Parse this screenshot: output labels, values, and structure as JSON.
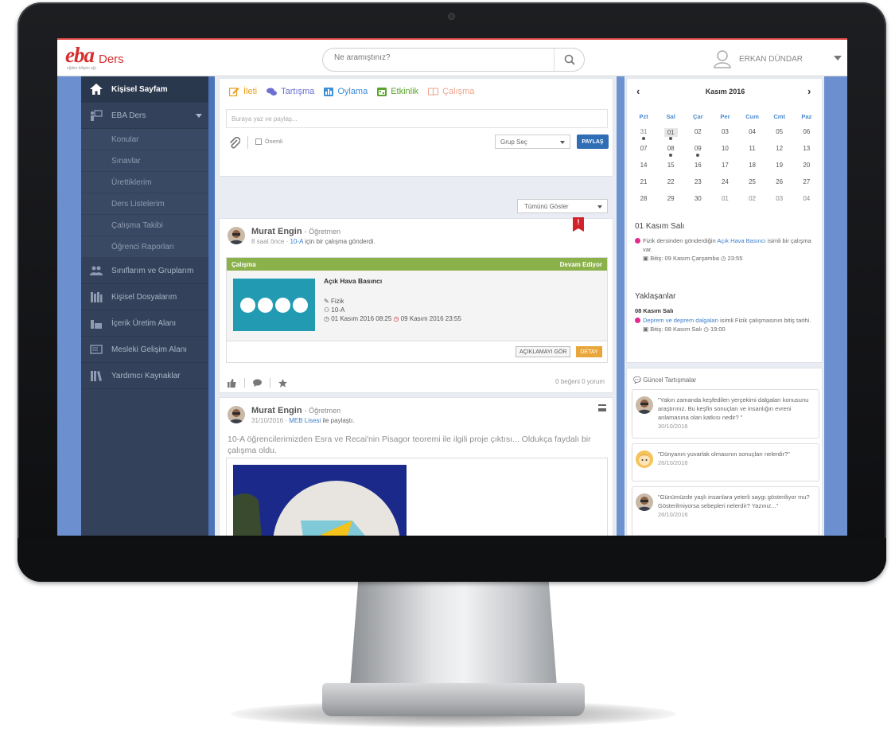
{
  "app": {
    "logo_text": "eba",
    "logo_sub": "Ders",
    "logo_tagline": "eğitim bilişim ağı"
  },
  "search": {
    "placeholder": "Ne aramıştınız?"
  },
  "user": {
    "name": "ERKAN DÜNDAR"
  },
  "sidebar": {
    "items": [
      {
        "label": "Kişisel Sayfam",
        "icon": "home-icon"
      },
      {
        "label": "EBA Ders",
        "icon": "teacher-board-icon"
      },
      {
        "label": "Konular"
      },
      {
        "label": "Sınavlar"
      },
      {
        "label": "Ürettiklerim"
      },
      {
        "label": "Ders Listelerim"
      },
      {
        "label": "Çalışma Takibi"
      },
      {
        "label": "Öğrenci Raporları"
      },
      {
        "label": "Sınıflarım ve Gruplarım",
        "icon": "users-icon"
      },
      {
        "label": "Kişisel Dosyalarım",
        "icon": "books-icon"
      },
      {
        "label": "İçerik Üretim Alanı",
        "icon": "tools-icon"
      },
      {
        "label": "Mesleki Gelişim Alanı",
        "icon": "certificate-icon"
      },
      {
        "label": "Yardımcı Kaynaklar",
        "icon": "library-icon"
      }
    ]
  },
  "composer": {
    "tabs": [
      {
        "label": "İleti",
        "color": "#e9a020"
      },
      {
        "label": "Tartışma",
        "color": "#6d6fd1"
      },
      {
        "label": "Oylama",
        "color": "#3d8ed8"
      },
      {
        "label": "Etkinlik",
        "color": "#5aa22c"
      },
      {
        "label": "Çalışma",
        "color": "#f0a58e"
      }
    ],
    "input_placeholder": "Buraya yaz ve paylaş...",
    "important_label": "Önemli",
    "group_select": "Grup Seç",
    "share_button": "PAYLAŞ"
  },
  "feed_filter": "Tümünü Göster",
  "posts": [
    {
      "author": "Murat Engin",
      "role": "- Öğretmen",
      "time": "8 saat önce",
      "dot": "·",
      "target": "10-A",
      "action": "için bir çalışma gönderdi.",
      "badge": "!",
      "work": {
        "header": "Çalışma",
        "status": "Devam Ediyor",
        "title": "Açık Hava Basıncı",
        "subject": "Fizik",
        "class": "10-A",
        "start": "01 Kasım 2016 08:25",
        "end": "09 Kasım 2016 23:55",
        "btn_description": "AÇIKLAMAYI GÖR",
        "btn_detail": "DETAY"
      },
      "likes": "0 beğeni",
      "comments": "0 yorum"
    },
    {
      "author": "Murat Engin",
      "role": "- Öğretmen",
      "time": "31/10/2016",
      "dot": "·",
      "target": "MEB Lisesi",
      "action": "ile paylaştı.",
      "text": "10-A öğrencilerimizden Esra ve Recai'nin Pisagor teoremi ile ilgili proje çıktısı... Oldukça faydalı bir çalışma oldu."
    }
  ],
  "calendar": {
    "prev": "‹",
    "next": "›",
    "title": "Kasım 2016",
    "weekdays": [
      "Pzt",
      "Sal",
      "Çar",
      "Per",
      "Cum",
      "Cmt",
      "Paz"
    ],
    "weeks": [
      [
        "31",
        "01",
        "02",
        "03",
        "04",
        "05",
        "06"
      ],
      [
        "07",
        "08",
        "09",
        "10",
        "11",
        "12",
        "13"
      ],
      [
        "14",
        "15",
        "16",
        "17",
        "18",
        "19",
        "20"
      ],
      [
        "21",
        "22",
        "23",
        "24",
        "25",
        "26",
        "27"
      ],
      [
        "28",
        "29",
        "30",
        "01",
        "02",
        "03",
        "04"
      ]
    ],
    "selected_date": "01 Kasım Salı",
    "event1_pre": "Fizik dersinden gönderdiğin",
    "event1_link": "Açık Hava Basıncı",
    "event1_post": "isimli bir çalışma var.",
    "event1_end": "Bitiş: 09 Kasım Çarşamba",
    "event1_time": "23:55",
    "upcoming_title": "Yaklaşanlar",
    "upcoming_date": "08 Kasım Salı",
    "event2_link": "Deprem ve deprem dalgaları",
    "event2_post": "isimli Fizik çalışmasının bitiş tarihi.",
    "event2_end": "Bitiş: 08 Kasım Salı",
    "event2_time": "19:00"
  },
  "discussions": {
    "title": "Güncel Tartışmalar",
    "items": [
      {
        "text": "\"Yakın zamanda keşfedilen yerçekimi dalgaları konusunu araştırınız. Bu keşfin sonuçları ve insanlığın evreni anlamasına olan katkısı nedir? \"",
        "date": "30/10/2016"
      },
      {
        "text": "\"Dünyanın yuvarlak olmasının sonuçları nelerdir?\"",
        "date": "26/10/2016"
      },
      {
        "text": "\"Günümüzde yaşlı insanlara yeterli saygı gösteriliyor mu? Gösterilmiyorsa sebepleri nelerdir? Yazınız...\"",
        "date": "26/10/2016"
      }
    ]
  },
  "colors": {
    "brand": "#d62e2e",
    "sidebar": "#33425a",
    "accent": "#2f6db5",
    "work_green": "#8bb14a",
    "event_dot": "#e6278f"
  }
}
